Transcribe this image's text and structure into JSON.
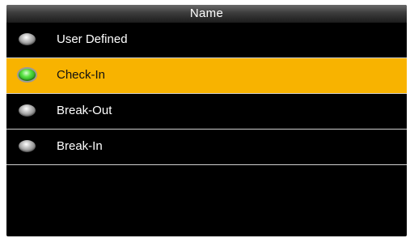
{
  "header": {
    "title": "Name"
  },
  "options": [
    {
      "label": "User Defined",
      "selected": false,
      "indicator_icon": "radio-off-icon"
    },
    {
      "label": "Check-In",
      "selected": true,
      "indicator_icon": "radio-on-icon"
    },
    {
      "label": "Break-Out",
      "selected": false,
      "indicator_icon": "radio-off-icon"
    },
    {
      "label": "Break-In",
      "selected": false,
      "indicator_icon": "radio-off-icon"
    }
  ],
  "colors": {
    "selected_row": "#f8b300",
    "background": "#000000",
    "radio_on": "#3fd02f",
    "radio_off": "#9a9a9a"
  }
}
